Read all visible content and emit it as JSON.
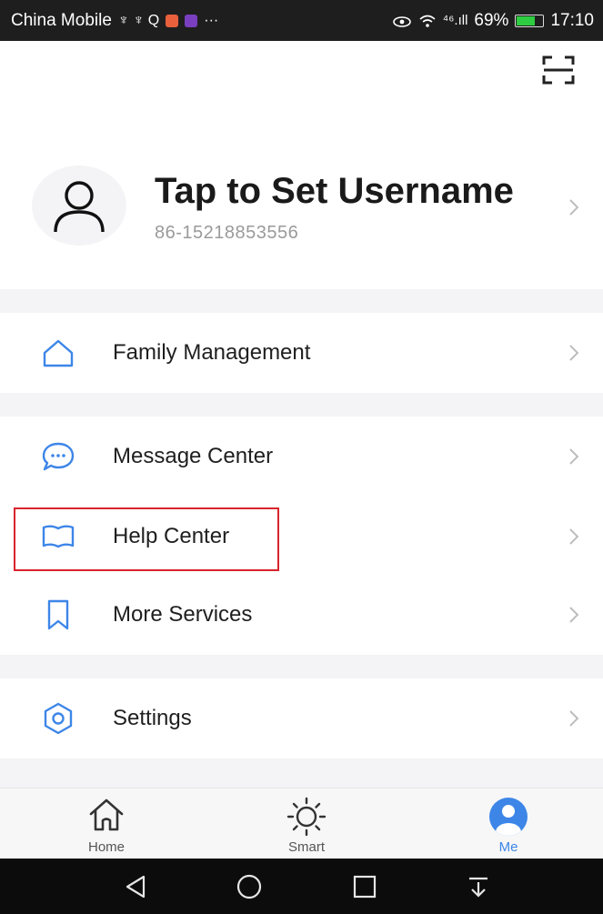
{
  "status_bar": {
    "carrier": "China Mobile",
    "left_symbols": "♆ ♆ Q",
    "more": "···",
    "signal": "⁴⁶.ıll",
    "battery_percent": "69%",
    "battery_level": 0.69,
    "time": "17:10"
  },
  "profile": {
    "username": "Tap to Set Username",
    "phone": "86-15218853556"
  },
  "menu": {
    "items": [
      {
        "label": "Family Management",
        "icon": "home-outline-icon"
      },
      {
        "label": "Message Center",
        "icon": "message-bubble-icon"
      },
      {
        "label": "Help Center",
        "icon": "book-icon"
      },
      {
        "label": "More Services",
        "icon": "bookmark-icon"
      },
      {
        "label": "Settings",
        "icon": "settings-hexagon-icon"
      }
    ]
  },
  "tabs": [
    {
      "label": "Home",
      "icon": "home-icon",
      "active": false
    },
    {
      "label": "Smart",
      "icon": "sun-icon",
      "active": false
    },
    {
      "label": "Me",
      "icon": "profile-icon",
      "active": true
    }
  ],
  "colors": {
    "accent": "#3d86e8",
    "highlight": "#d9242b",
    "divider": "#f4f4f6",
    "status_bar": "#1e1e1e"
  }
}
